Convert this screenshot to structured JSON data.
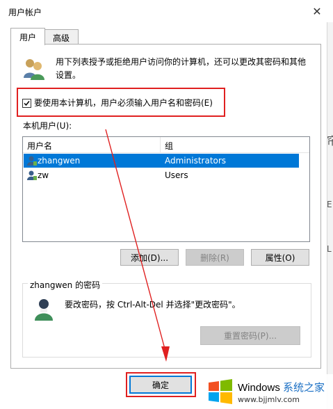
{
  "window": {
    "title": "用户帐户",
    "close_glyph": "✕"
  },
  "tabs": [
    {
      "label": "用户",
      "active": true
    },
    {
      "label": "高级",
      "active": false
    }
  ],
  "description": "用下列表授予或拒绝用户访问你的计算机，还可以更改其密码和其他设置。",
  "require_password": {
    "label": "要使用本计算机，用户必须输入用户名和密码(E)",
    "checked": true
  },
  "local_users": {
    "label": "本机用户(U):",
    "columns": [
      "用户名",
      "组"
    ],
    "rows": [
      {
        "user": "zhangwen",
        "group": "Administrators",
        "selected": true
      },
      {
        "user": "zw",
        "group": "Users",
        "selected": false
      }
    ]
  },
  "user_buttons": {
    "add": "添加(D)...",
    "remove": "删除(R)",
    "properties": "属性(O)"
  },
  "password_group": {
    "title": "zhangwen 的密码",
    "text": "要改密码，按 Ctrl-Alt-Del 并选择\"更改密码\"。",
    "reset_button": "重置密码(P)..."
  },
  "ok_button": "确定",
  "right_strip": [
    "帘",
    "E",
    "L"
  ],
  "watermark": {
    "brand": "Windows",
    "site_cn": "系统之家",
    "url": "www.bjjmlv.com"
  },
  "colors": {
    "selection": "#0078d7",
    "annotation": "#e02020",
    "accent": "#0078d7"
  }
}
